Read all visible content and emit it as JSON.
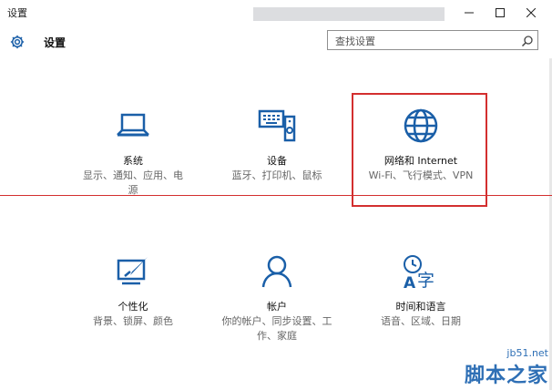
{
  "window": {
    "title": "设置"
  },
  "header": {
    "app_title": "设置",
    "search_placeholder": "查找设置"
  },
  "tiles": [
    {
      "title": "系统",
      "subtitle_lines": [
        "显示、通知、应用、电",
        "源"
      ],
      "icon": "laptop-icon"
    },
    {
      "title": "设备",
      "subtitle_lines": [
        "蓝牙、打印机、鼠标"
      ],
      "icon": "devices-icon"
    },
    {
      "title": "网络和 Internet",
      "subtitle_lines": [
        "Wi-Fi、飞行模式、VPN"
      ],
      "icon": "globe-icon"
    },
    {
      "title": "个性化",
      "subtitle_lines": [
        "背景、锁屏、颜色"
      ],
      "icon": "personalize-icon"
    },
    {
      "title": "帐户",
      "subtitle_lines": [
        "你的帐户、同步设置、工",
        "作、家庭"
      ],
      "icon": "person-icon"
    },
    {
      "title": "时间和语言",
      "subtitle_lines": [
        "语音、区域、日期"
      ],
      "icon": "time-language-icon"
    }
  ],
  "watermark": {
    "url": "jb51.net",
    "name": "脚本之家"
  },
  "colors": {
    "accent": "#1a5fa8",
    "highlight": "#d32f2f"
  }
}
